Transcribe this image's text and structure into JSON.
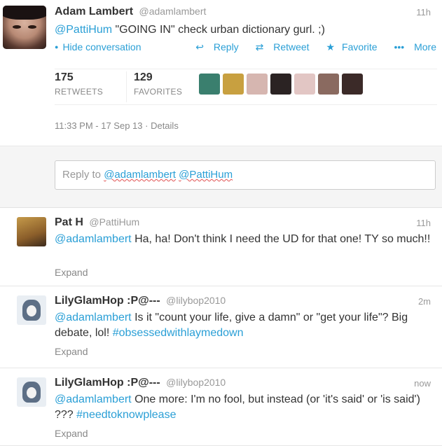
{
  "main_tweet": {
    "name": "Adam Lambert",
    "handle": "@adamlambert",
    "time": "11h",
    "mention": "@PattiHum",
    "text": " \"GOING IN\" check urban dictionary gurl. ;)",
    "hide_conversation": "Hide conversation",
    "actions": {
      "reply": "Reply",
      "retweet": "Retweet",
      "favorite": "Favorite",
      "more": "More"
    },
    "retweets_count": "175",
    "retweets_label": "RETWEETS",
    "favorites_count": "129",
    "favorites_label": "FAVORITES",
    "favoriter_colors": [
      "#3a7f6e",
      "#c8a040",
      "#d6b6b0",
      "#2b2323",
      "#e2c6c4",
      "#8a6a60",
      "#3b2a28"
    ],
    "timestamp": "11:33 PM - 17 Sep 13",
    "details": "Details"
  },
  "reply_box": {
    "prefix": "Reply to ",
    "mention1": "@adamlambert",
    "mention2": "@PattiHum"
  },
  "replies": [
    {
      "name": "Pat H",
      "handle": "@PattiHum",
      "time": "11h",
      "mention": "@adamlambert",
      "text": " Ha, ha! Don't think I need the UD for that one! TY so much!!",
      "hashtag": "",
      "expand": "Expand"
    },
    {
      "name": "LilyGlamHop :P@---",
      "handle": "@lilybop2010",
      "time": "2m",
      "mention": "@adamlambert",
      "text": " Is it \"count your life, give a damn\" or \"get your life\"? Big debate, lol! ",
      "hashtag": "#obsessedwithlaymedown",
      "expand": "Expand"
    },
    {
      "name": "LilyGlamHop :P@---",
      "handle": "@lilybop2010",
      "time": "now",
      "mention": "@adamlambert",
      "text": " One more:   I'm no fool, but instead (or 'it's said' or 'is said')  ??? ",
      "hashtag": "#needtoknowplease",
      "expand": "Expand"
    }
  ]
}
